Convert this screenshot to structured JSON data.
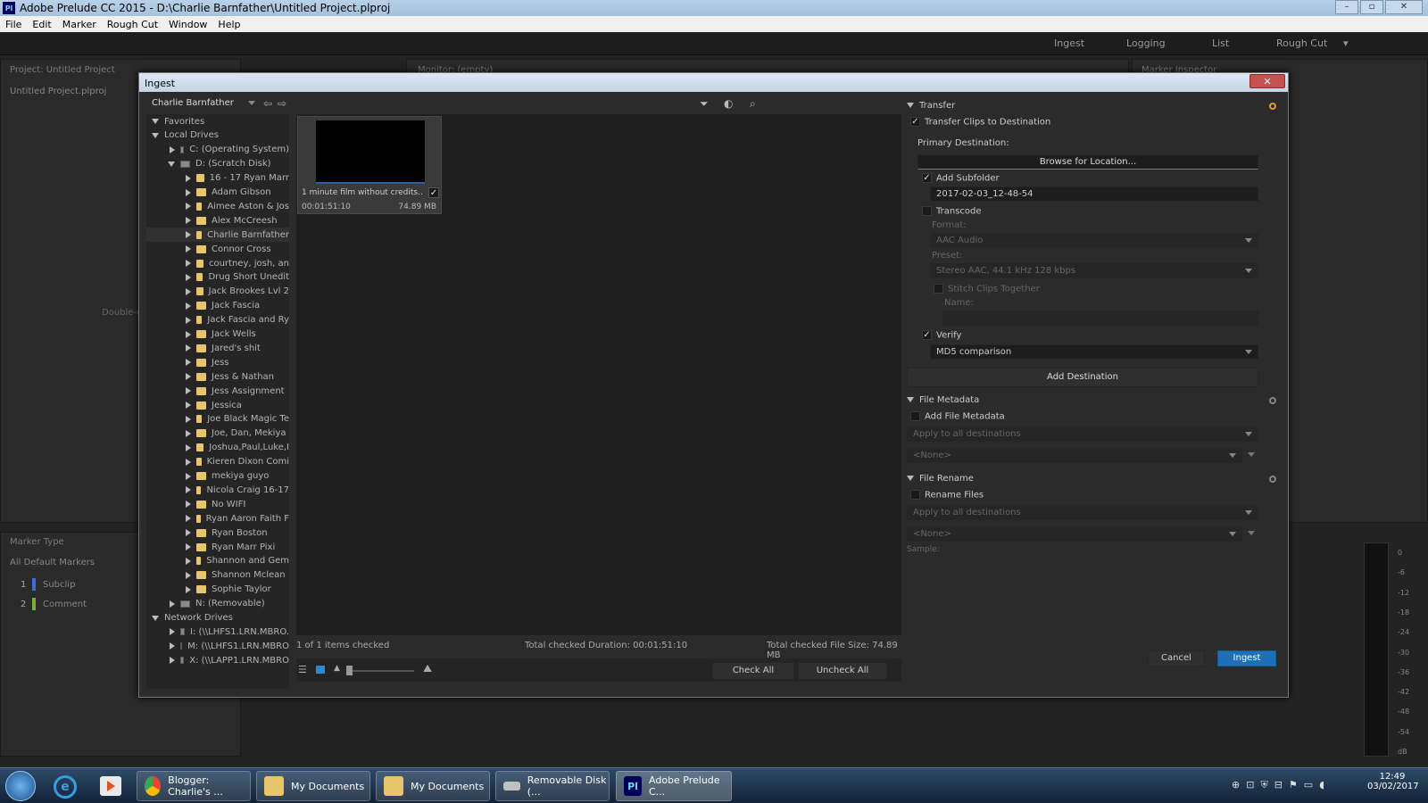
{
  "window": {
    "title": "Adobe Prelude CC 2015 - D:\\Charlie Barnfather\\Untitled Project.plproj",
    "logo": "Pl"
  },
  "menu": [
    "File",
    "Edit",
    "Marker",
    "Rough Cut",
    "Window",
    "Help"
  ],
  "workspaces": [
    "Ingest",
    "Logging",
    "List",
    "Rough Cut"
  ],
  "project_panel": {
    "title": "Project: Untitled Project",
    "item": "Untitled Project.plproj",
    "hint": "Double-cl"
  },
  "monitor_panel": {
    "title": "Monitor: (empty)"
  },
  "marker_inspector": {
    "title": "Marker Inspector"
  },
  "marker_type": {
    "title": "Marker Type",
    "filter": "All Default Markers",
    "items": [
      {
        "num": "1",
        "label": "Subclip",
        "color": "#3a6fd8"
      },
      {
        "num": "2",
        "label": "Comment",
        "color": "#7ab030"
      }
    ]
  },
  "dialog": {
    "title": "Ingest",
    "close": "✕",
    "location": "Charlie Barnfather",
    "tree": [
      {
        "label": "Favorites",
        "level": 0,
        "state": "open",
        "type": "none"
      },
      {
        "label": "Local Drives",
        "level": 0,
        "state": "open",
        "type": "none"
      },
      {
        "label": "C: (Operating System)",
        "level": 1,
        "state": "closed",
        "type": "drive"
      },
      {
        "label": "D: (Scratch Disk)",
        "level": 1,
        "state": "open",
        "type": "drive"
      },
      {
        "label": "16 - 17 Ryan Marr",
        "level": 2,
        "state": "closed",
        "type": "folder"
      },
      {
        "label": "Adam Gibson",
        "level": 2,
        "state": "closed",
        "type": "folder"
      },
      {
        "label": "Aimee Aston & Jos",
        "level": 2,
        "state": "closed",
        "type": "folder"
      },
      {
        "label": "Alex McCreesh",
        "level": 2,
        "state": "closed",
        "type": "folder"
      },
      {
        "label": "Charlie Barnfather",
        "level": 2,
        "state": "closed",
        "type": "folder"
      },
      {
        "label": "Connor Cross",
        "level": 2,
        "state": "closed",
        "type": "folder"
      },
      {
        "label": "courtney, josh, an",
        "level": 2,
        "state": "closed",
        "type": "folder"
      },
      {
        "label": "Drug Short Unedit",
        "level": 2,
        "state": "closed",
        "type": "folder"
      },
      {
        "label": "Jack Brookes Lvl 2",
        "level": 2,
        "state": "closed",
        "type": "folder"
      },
      {
        "label": "Jack Fascia",
        "level": 2,
        "state": "closed",
        "type": "folder"
      },
      {
        "label": "Jack Fascia and Ry",
        "level": 2,
        "state": "closed",
        "type": "folder"
      },
      {
        "label": "Jack Wells",
        "level": 2,
        "state": "closed",
        "type": "folder"
      },
      {
        "label": "Jared's shit",
        "level": 2,
        "state": "closed",
        "type": "folder"
      },
      {
        "label": "Jess",
        "level": 2,
        "state": "closed",
        "type": "folder"
      },
      {
        "label": "Jess & Nathan",
        "level": 2,
        "state": "closed",
        "type": "folder"
      },
      {
        "label": "Jess Assignment",
        "level": 2,
        "state": "closed",
        "type": "folder"
      },
      {
        "label": "Jessica",
        "level": 2,
        "state": "closed",
        "type": "folder"
      },
      {
        "label": "Joe Black Magic Te",
        "level": 2,
        "state": "closed",
        "type": "folder"
      },
      {
        "label": "Joe, Dan, Mekiya",
        "level": 2,
        "state": "closed",
        "type": "folder"
      },
      {
        "label": "Joshua,Paul,Luke,I",
        "level": 2,
        "state": "closed",
        "type": "folder"
      },
      {
        "label": "Kieren Dixon Comi",
        "level": 2,
        "state": "closed",
        "type": "folder"
      },
      {
        "label": "mekiya guyo",
        "level": 2,
        "state": "closed",
        "type": "folder"
      },
      {
        "label": "Nicola Craig 16-17",
        "level": 2,
        "state": "closed",
        "type": "folder"
      },
      {
        "label": "No WIFI",
        "level": 2,
        "state": "closed",
        "type": "folder"
      },
      {
        "label": "Ryan Aaron Faith F",
        "level": 2,
        "state": "closed",
        "type": "folder"
      },
      {
        "label": "Ryan Boston",
        "level": 2,
        "state": "closed",
        "type": "folder"
      },
      {
        "label": "Ryan Marr Pixi",
        "level": 2,
        "state": "closed",
        "type": "folder"
      },
      {
        "label": "Shannon and Gem",
        "level": 2,
        "state": "closed",
        "type": "folder"
      },
      {
        "label": "Shannon Mclean",
        "level": 2,
        "state": "closed",
        "type": "folder"
      },
      {
        "label": "Sophie Taylor",
        "level": 2,
        "state": "closed",
        "type": "folder"
      },
      {
        "label": "N: (Removable)",
        "level": 1,
        "state": "closed",
        "type": "drive"
      },
      {
        "label": "Network Drives",
        "level": 0,
        "state": "open",
        "type": "none"
      },
      {
        "label": "I: (\\\\LHFS1.LRN.MBRO.",
        "level": 1,
        "state": "closed",
        "type": "drive"
      },
      {
        "label": "M: (\\\\LHFS1.LRN.MBRO",
        "level": 1,
        "state": "closed",
        "type": "drive"
      },
      {
        "label": "X: (\\\\LAPP1.LRN.MBRO",
        "level": 1,
        "state": "closed",
        "type": "drive"
      }
    ],
    "clip": {
      "name": "1 minute film without credits....",
      "duration": "00:01:51:10",
      "size": "74.89 MB",
      "checked": "✓"
    },
    "status": {
      "checked": "1 of 1 items checked",
      "duration": "Total checked Duration: 00:01:51:10",
      "size": "Total checked File Size: 74.89 MB"
    },
    "check_all": "Check All",
    "uncheck_all": "Uncheck All",
    "transfer": {
      "title": "Transfer",
      "transfer_clips": "Transfer Clips to Destination",
      "primary_dest": "Primary Destination:",
      "browse": "Browse for Location...",
      "add_subfolder": "Add Subfolder",
      "subfolder": "2017-02-03_12-48-54",
      "transcode": "Transcode",
      "format_label": "Format:",
      "format": "AAC Audio",
      "preset_label": "Preset:",
      "preset": "Stereo AAC, 44.1 kHz 128 kbps",
      "stitch": "Stitch Clips Together",
      "name_label": "Name:",
      "verify": "Verify",
      "verify_method": "MD5 comparison",
      "add_destination": "Add Destination"
    },
    "file_metadata": {
      "title": "File Metadata",
      "add": "Add File Metadata",
      "apply": "Apply to all destinations",
      "none": "<None>"
    },
    "file_rename": {
      "title": "File Rename",
      "rename": "Rename Files",
      "apply": "Apply to all destinations",
      "none": "<None>",
      "sample": "Sample:"
    },
    "cancel": "Cancel",
    "ingest": "Ingest"
  },
  "meter": {
    "labels": [
      "0",
      "-6",
      "-12",
      "-18",
      "-24",
      "-30",
      "-36",
      "-42",
      "-48",
      "-54",
      "dB"
    ]
  },
  "taskbar": {
    "buttons": [
      "Blogger: Charlie's ...",
      "My Documents",
      "My Documents",
      "Removable Disk (...",
      "Adobe Prelude C..."
    ],
    "time": "12:49",
    "date": "03/02/2017"
  },
  "colors": {
    "accent": "#1f6fb8",
    "folder": "#e8c46a"
  }
}
